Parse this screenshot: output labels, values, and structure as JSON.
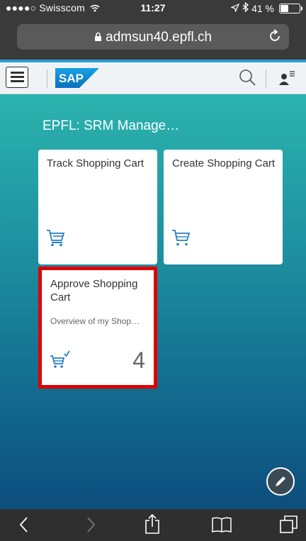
{
  "status": {
    "carrier": "●●●●○ Swisscom",
    "time": "11:27",
    "battery_text": "41 %",
    "battery_level": 0.41
  },
  "browser": {
    "url": "admsun40.epfl.ch"
  },
  "shell": {
    "logo_text": "SAP"
  },
  "main": {
    "group_title": "EPFL: SRM Manage…",
    "tiles": [
      {
        "title": "Track Shopping Cart",
        "subtitle": "",
        "count": ""
      },
      {
        "title": "Create Shopping Cart",
        "subtitle": "",
        "count": ""
      },
      {
        "title": "Approve Shopping Cart",
        "subtitle": "Overview of my Shop…",
        "count": "4"
      }
    ]
  },
  "colors": {
    "accent": "#2a9bd6",
    "tile_icon": "#2a7fc1",
    "highlight": "#e00000"
  },
  "icons": [
    "wifi-icon",
    "bluetooth-icon",
    "location-arrow-icon",
    "lock-icon",
    "reload-icon",
    "menu-icon",
    "search-icon",
    "user-menu-icon",
    "cart-track-icon",
    "cart-create-icon",
    "cart-approve-icon",
    "edit-icon",
    "back-icon",
    "forward-icon",
    "share-icon",
    "bookmarks-icon",
    "tabs-icon"
  ]
}
